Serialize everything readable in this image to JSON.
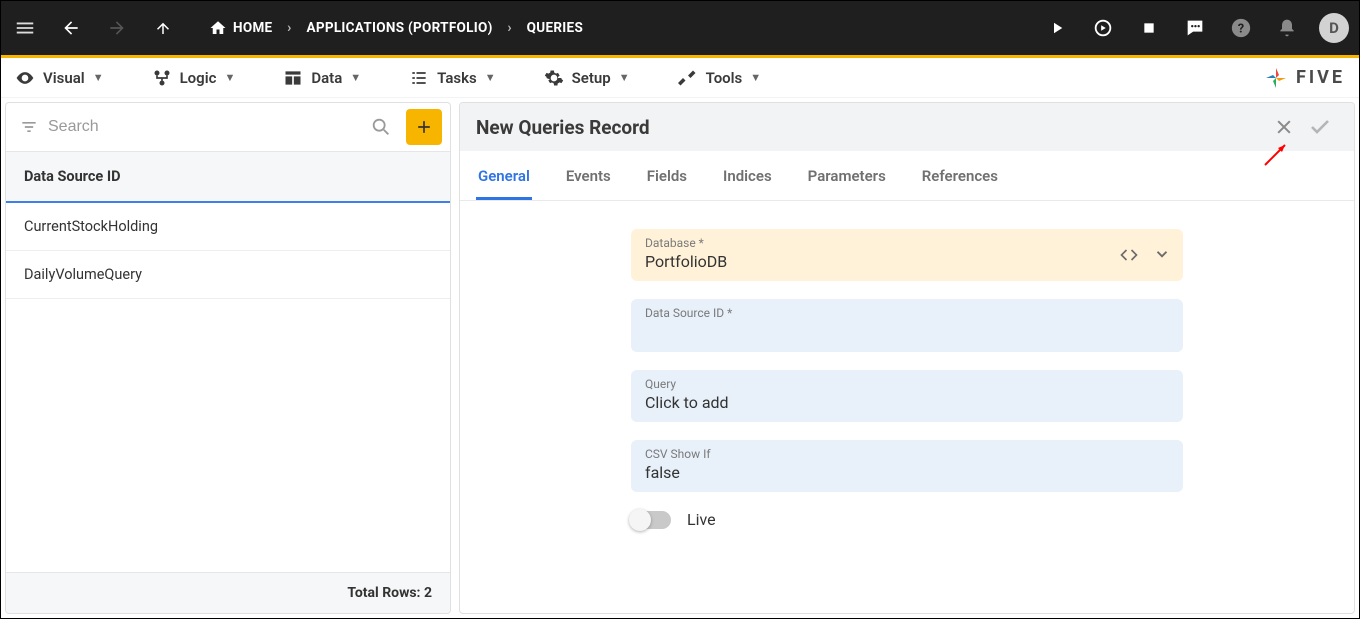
{
  "breadcrumb": {
    "home": "HOME",
    "applications": "APPLICATIONS (PORTFOLIO)",
    "queries": "QUERIES"
  },
  "avatar_initial": "D",
  "menubar": {
    "visual": "Visual",
    "logic": "Logic",
    "data": "Data",
    "tasks": "Tasks",
    "setup": "Setup",
    "tools": "Tools"
  },
  "logo_text": "FIVE",
  "sidebar": {
    "search_placeholder": "Search",
    "column_header": "Data Source ID",
    "rows": [
      "CurrentStockHolding",
      "DailyVolumeQuery"
    ],
    "total_label": "Total Rows: 2"
  },
  "detail": {
    "title": "New Queries Record",
    "tabs": [
      "General",
      "Events",
      "Fields",
      "Indices",
      "Parameters",
      "References"
    ],
    "active_tab": 0,
    "fields": {
      "database_label": "Database *",
      "database_value": "PortfolioDB",
      "datasource_label": "Data Source ID *",
      "datasource_value": "",
      "query_label": "Query",
      "query_value": "Click to add",
      "csv_label": "CSV Show If",
      "csv_value": "false",
      "live_label": "Live"
    }
  }
}
